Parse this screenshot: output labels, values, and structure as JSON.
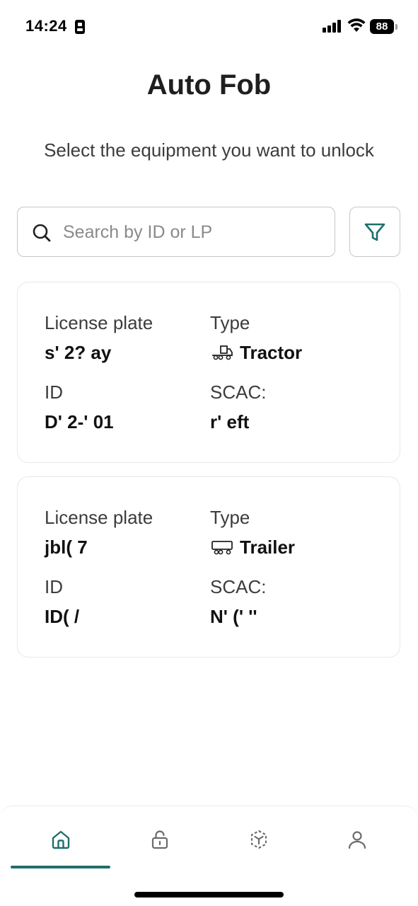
{
  "status_bar": {
    "time": "14:24",
    "battery": "88"
  },
  "header": {
    "title": "Auto Fob",
    "subtitle": "Select the equipment you want to unlock"
  },
  "search": {
    "placeholder": "Search by ID or LP",
    "value": ""
  },
  "equipment": [
    {
      "license_plate_label": "License plate",
      "license_plate": "s'  2?  ay",
      "type_label": "Type",
      "type": "Tractor",
      "type_icon": "tractor-icon",
      "id_label": "ID",
      "id": "D'  2-'  01",
      "scac_label": "SCAC:",
      "scac": "r'  eft"
    },
    {
      "license_plate_label": "License plate",
      "license_plate": "jbl(  7",
      "type_label": "Type",
      "type": "Trailer",
      "type_icon": "trailer-icon",
      "id_label": "ID",
      "id": "ID(  /",
      "scac_label": "SCAC:",
      "scac": "N'  ('  ''"
    }
  ],
  "bottom_nav": {
    "tabs": [
      {
        "icon": "home-icon",
        "active": true
      },
      {
        "icon": "unlock-icon",
        "active": false
      },
      {
        "icon": "scan-icon",
        "active": false
      },
      {
        "icon": "profile-icon",
        "active": false
      }
    ]
  },
  "colors": {
    "accent": "#1f6f6c",
    "border": "#c7c7c7",
    "card_border": "#e8e8e8"
  }
}
